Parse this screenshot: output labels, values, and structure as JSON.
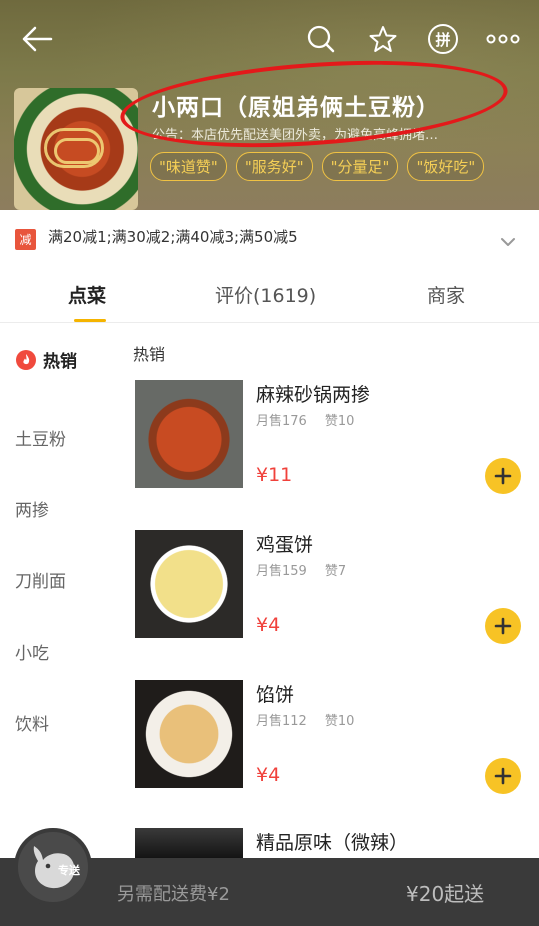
{
  "shop": {
    "name": "小两口（原姐弟俩土豆粉）",
    "notice": "公告：本店优先配送美团外卖，为避免高峰拥堵…",
    "tags": [
      "\"味道赞\"",
      "\"服务好\"",
      "\"分量足\"",
      "\"饭好吃\""
    ]
  },
  "promo": {
    "badge": "减",
    "text": "满20减1;满30减2;满40减3;满50减5"
  },
  "tabs": {
    "order": "点菜",
    "reviews": "评价(1619)",
    "merchant": "商家"
  },
  "categories": [
    "热销",
    "土豆粉",
    "两掺",
    "刀削面",
    "小吃",
    "饮料"
  ],
  "menu": {
    "section_title": "热销",
    "dishes": [
      {
        "name": "麻辣砂锅两掺",
        "monthly_sales": "月售176",
        "likes": "赞10",
        "price": "¥11"
      },
      {
        "name": "鸡蛋饼",
        "monthly_sales": "月售159",
        "likes": "赞7",
        "price": "¥4"
      },
      {
        "name": "馅饼",
        "monthly_sales": "月售112",
        "likes": "赞10",
        "price": "¥4"
      },
      {
        "name": "精品原味（微辣）",
        "monthly_sales": "",
        "likes": "",
        "price": ""
      }
    ]
  },
  "bottom": {
    "cart_badge": "专送",
    "delivery_fee": "另需配送费¥2",
    "min_order": "¥20起送"
  },
  "colors": {
    "accent": "#f7c325",
    "price": "#f0413b",
    "tag": "#f0c243",
    "annotation_circle": "#e3191a"
  },
  "icons": {
    "back": "arrow-left-icon",
    "search": "search-icon",
    "favorite": "star-icon",
    "group": "pin-icon",
    "more": "more-dots-icon",
    "hot": "flame-icon",
    "add": "plus-icon",
    "cart": "cart-mascot-icon"
  }
}
